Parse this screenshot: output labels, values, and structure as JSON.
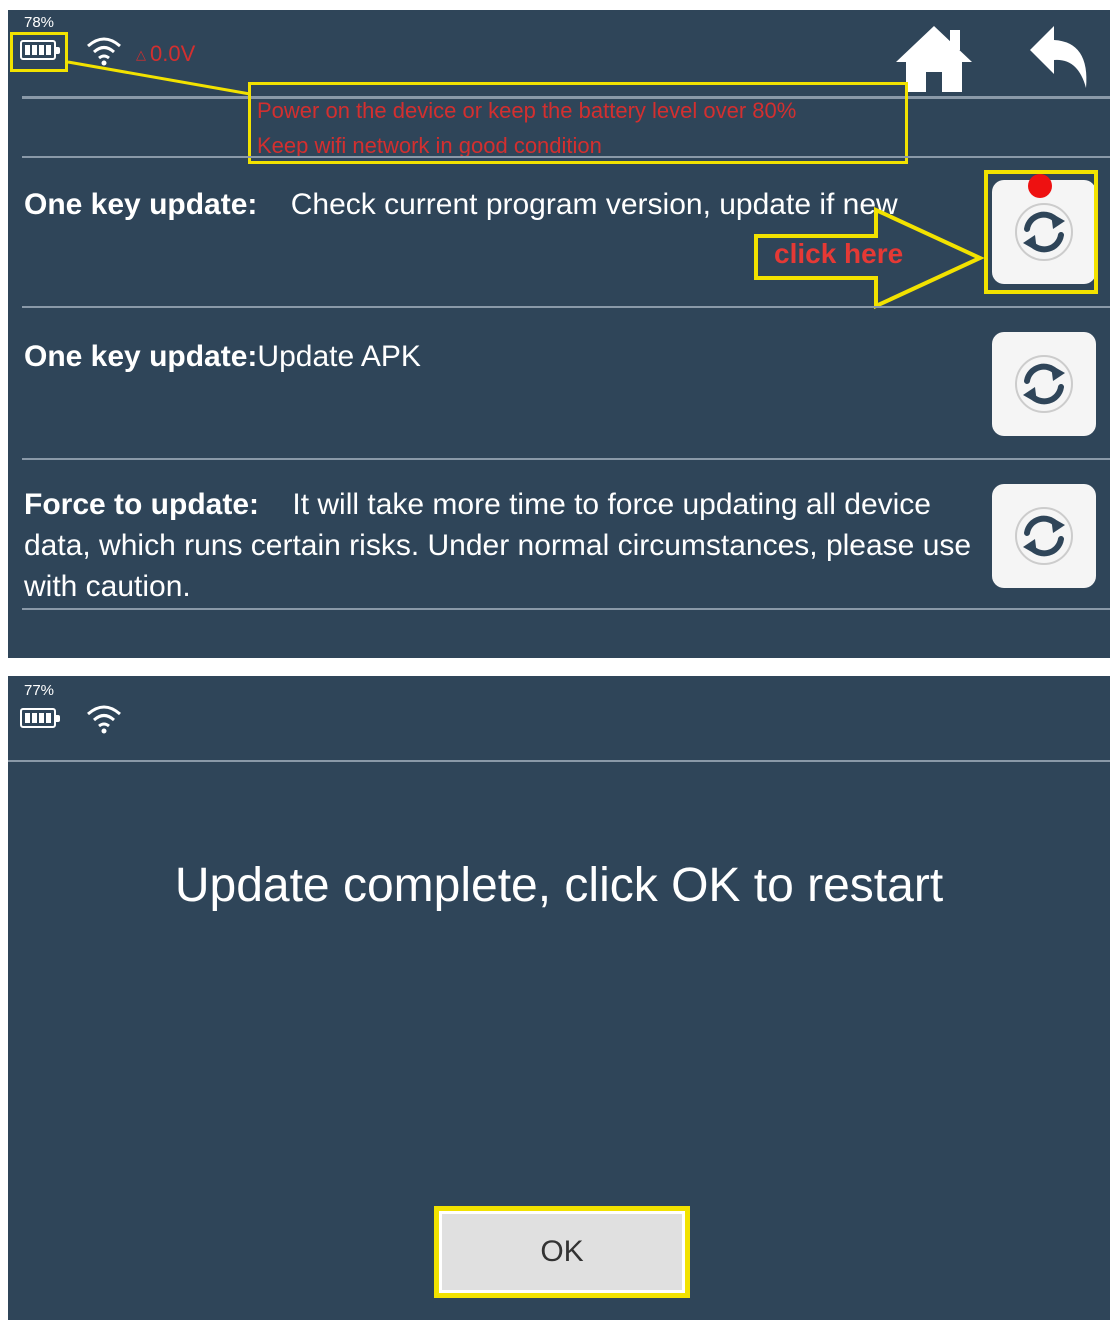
{
  "screen1": {
    "status": {
      "battery_pct": "78%",
      "voltage": "0.0V"
    },
    "note_lines": [
      "Power on the device or keep the battery level over 80%",
      "Keep wifi network in good condition"
    ],
    "rows": [
      {
        "title": "One key update:",
        "desc": "Check current program version, update if new"
      },
      {
        "title": "One key update:",
        "desc": "Update APK"
      },
      {
        "title": "Force to update:",
        "desc": "It will take more time to force updating all device data, which runs certain risks. Under normal circumstances, please use with caution."
      }
    ],
    "click_hint": "click here",
    "icons": {
      "home": "home-icon",
      "back": "back-arrow-icon",
      "refresh": "refresh-icon"
    }
  },
  "screen2": {
    "status": {
      "battery_pct": "77%"
    },
    "message": "Update complete,  click OK to restart",
    "ok_label": "OK"
  },
  "colors": {
    "background": "#2f4559",
    "highlight": "#f2e200",
    "warning_text": "#d32f2f"
  }
}
